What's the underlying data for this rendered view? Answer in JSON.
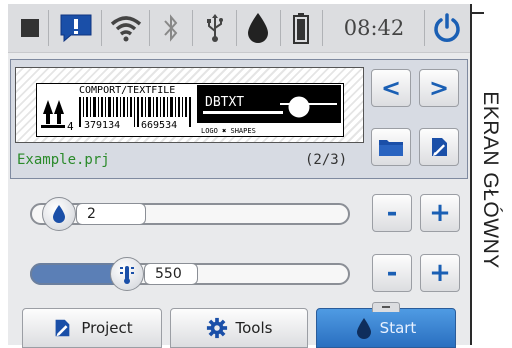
{
  "status_bar": {
    "time": "08:42",
    "icons": [
      "stop-icon",
      "message-icon",
      "wifi-icon",
      "bluetooth-icon",
      "usb-icon",
      "ink-drop-icon",
      "battery-icon",
      "power-icon"
    ]
  },
  "preview": {
    "label": {
      "header_text": "COMPORT/TEXTFILE",
      "small_digit": "4",
      "barcode_left": "379134",
      "barcode_right": "669534",
      "dbtxt": "DBTXT",
      "logo_text": "LOGO ✖ SHAPES"
    },
    "project_name": "Example.prj",
    "project_count": "(2/3)"
  },
  "nav": {
    "prev_symbol": "<",
    "next_symbol": ">"
  },
  "sliders": [
    {
      "name": "ink",
      "value": "2",
      "minus": "-",
      "plus": "+",
      "level": 0
    },
    {
      "name": "temperature",
      "value": "550",
      "minus": "-",
      "plus": "+",
      "level": 0.27
    }
  ],
  "bottom": {
    "project_label": "Project",
    "tools_label": "Tools",
    "start_label": "Start"
  },
  "side_title": "EKRAN GŁÓWNY",
  "colors": {
    "accent": "#1a5fb4",
    "start": "#2a6fc0",
    "project_name": "#2a8a2a"
  }
}
